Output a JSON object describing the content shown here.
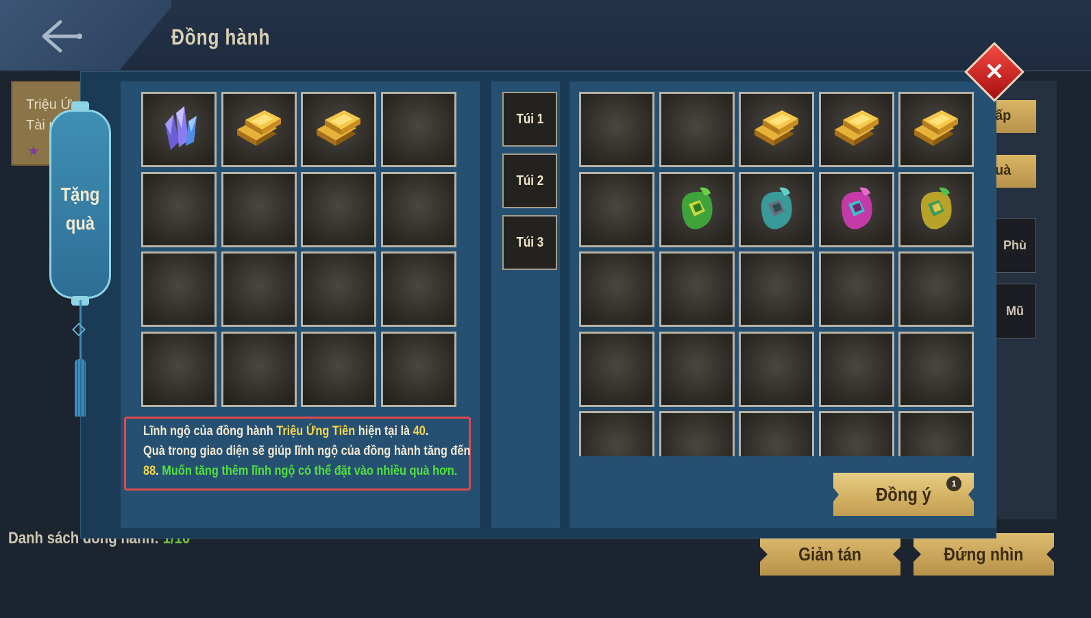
{
  "header": {
    "title": "Đồng hành"
  },
  "background": {
    "card_name": "Triệu Ứng",
    "card_sub": "Tài ph",
    "card_stars": "★",
    "right_buttons": [
      "ấp",
      "uà"
    ],
    "right_slots": [
      "Phù",
      "Mũ"
    ],
    "list_label": "Danh sách đồng hành:",
    "list_count": "1/10",
    "disband_label": "Giản tán",
    "watch_label": "Đứng nhìn"
  },
  "gift_panel": {
    "tab_label_line1": "Tặng",
    "tab_label_line2": "quà",
    "slots": [
      "crystal-item",
      "gold-bars-item",
      "gold-bars-item",
      "",
      "",
      "",
      "",
      "",
      "",
      "",
      "",
      "",
      "",
      "",
      "",
      ""
    ],
    "info": {
      "l1_pre": "Lĩnh ngộ của đồng hành ",
      "l1_name": "Triệu Ứng Tiên",
      "l1_mid": " hiện tại là ",
      "l1_val": "40",
      "l1_end": ".",
      "l2": "Quà trong giao diện sẽ giúp lĩnh ngộ của đồng hành tăng đến",
      "l3_val": "88",
      "l3_dot": ". ",
      "l3_green": "Muốn tăng thêm lĩnh ngộ có thể đặt vào nhiều quà hơn."
    }
  },
  "bags": {
    "tabs": [
      "Túi 1",
      "Túi 2",
      "Túi 3"
    ]
  },
  "inventory": {
    "slots": [
      "",
      "",
      "gold-bars-item",
      "gold-bars-item",
      "gold-bars-item",
      "",
      "green-pouch-item",
      "teal-pouch-item",
      "magenta-pouch-item",
      "yellow-pouch-item",
      "",
      "",
      "",
      "",
      "",
      "",
      "",
      "",
      "",
      "",
      "",
      "",
      "",
      "",
      ""
    ]
  },
  "confirm": {
    "label": "Đồng ý",
    "badge": "1"
  },
  "colors": {
    "accent_gold": "#d4b264",
    "highlight_yellow": "#f8d64a",
    "highlight_green": "#52e03a",
    "close_red": "#d8201e"
  }
}
